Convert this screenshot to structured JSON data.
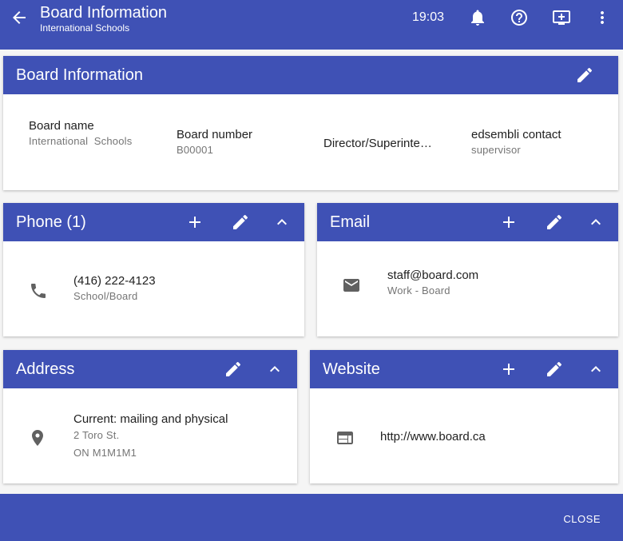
{
  "header": {
    "title": "Board Information",
    "subtitle": "International Schools",
    "time": "19:03",
    "icons": [
      "arrow-back-icon",
      "bell-icon",
      "help-icon",
      "screen-share-icon",
      "more-vert-icon"
    ]
  },
  "board_info": {
    "title": "Board Information",
    "fields": [
      {
        "label": "Board name",
        "value": "International  Schools"
      },
      {
        "label": "Board number",
        "value": "B00001"
      },
      {
        "label": "Director/Superinte…",
        "value": ""
      },
      {
        "label": "edsembli contact",
        "value": "supervisor"
      }
    ]
  },
  "phone": {
    "title": "Phone (1)",
    "number": "(416) 222-4123",
    "type": "School/Board"
  },
  "email": {
    "title": "Email",
    "address": "staff@board.com",
    "type": "Work - Board"
  },
  "address": {
    "title": "Address",
    "kind": "Current: mailing and physical",
    "line1": "2 Toro St.",
    "line2": "ON M1M1M1"
  },
  "website": {
    "title": "Website",
    "url": "http://www.board.ca"
  },
  "footer": {
    "close_label": "CLOSE"
  },
  "colors": {
    "primary": "#3f51b5",
    "background": "#f5f5f5",
    "icon_grey": "#616161"
  }
}
